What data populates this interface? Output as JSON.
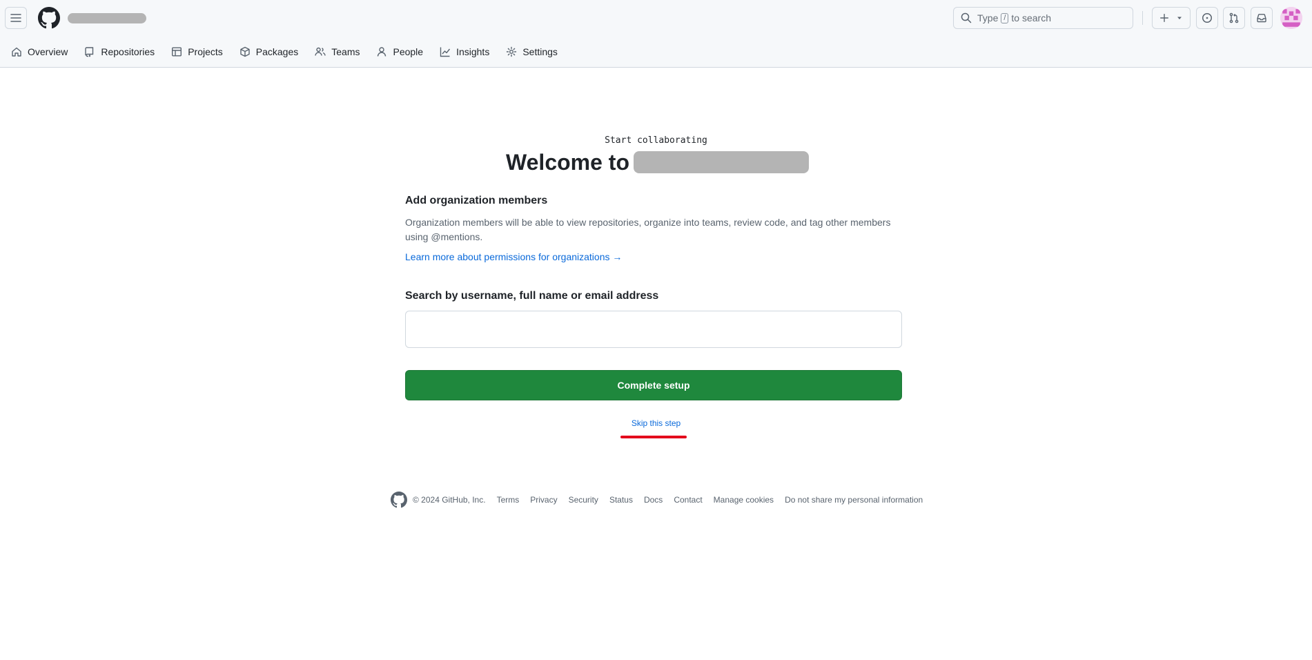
{
  "header": {
    "search": {
      "prefix": "Type",
      "key": "/",
      "suffix": "to search"
    }
  },
  "nav": {
    "items": [
      {
        "label": "Overview",
        "icon": "home-icon"
      },
      {
        "label": "Repositories",
        "icon": "repo-icon"
      },
      {
        "label": "Projects",
        "icon": "table-icon"
      },
      {
        "label": "Packages",
        "icon": "package-icon"
      },
      {
        "label": "Teams",
        "icon": "people-icon"
      },
      {
        "label": "People",
        "icon": "person-icon"
      },
      {
        "label": "Insights",
        "icon": "graph-icon"
      },
      {
        "label": "Settings",
        "icon": "gear-icon"
      }
    ]
  },
  "main": {
    "kicker": "Start collaborating",
    "welcome_prefix": "Welcome to",
    "section_title": "Add organization members",
    "section_desc": "Organization members will be able to view repositories, organize into teams, review code, and tag other members using @mentions.",
    "learn_more": "Learn more about permissions for organizations →",
    "field_label": "Search by username, full name or email address",
    "field_value": "",
    "complete_button": "Complete setup",
    "skip_link": "Skip this step"
  },
  "footer": {
    "copyright": "© 2024 GitHub, Inc.",
    "links": [
      "Terms",
      "Privacy",
      "Security",
      "Status",
      "Docs",
      "Contact",
      "Manage cookies",
      "Do not share my personal information"
    ]
  },
  "colors": {
    "primary_button": "#1f883d",
    "link": "#0969da",
    "annotation_underline": "#e3001b",
    "header_bg": "#f6f8fa"
  }
}
